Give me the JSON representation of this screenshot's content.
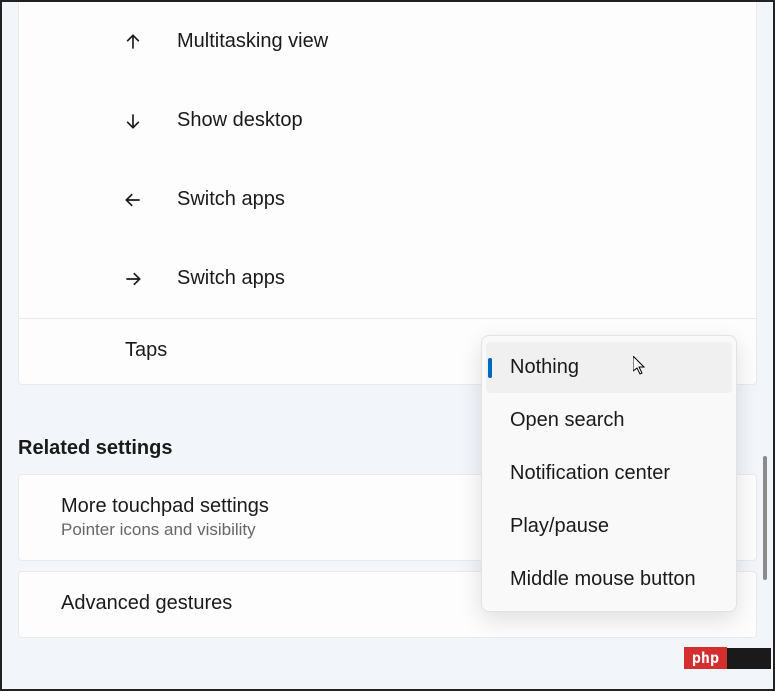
{
  "gestures": [
    {
      "label": "Multitasking view",
      "icon": "arrow-up"
    },
    {
      "label": "Show desktop",
      "icon": "arrow-down"
    },
    {
      "label": "Switch apps",
      "icon": "arrow-left"
    },
    {
      "label": "Switch apps",
      "icon": "arrow-right"
    }
  ],
  "taps": {
    "label": "Taps"
  },
  "dropdown": {
    "items": [
      {
        "label": "Nothing",
        "selected": true
      },
      {
        "label": "Open search",
        "selected": false
      },
      {
        "label": "Notification center",
        "selected": false
      },
      {
        "label": "Play/pause",
        "selected": false
      },
      {
        "label": "Middle mouse button",
        "selected": false
      }
    ]
  },
  "related": {
    "header": "Related settings",
    "more_touchpad": {
      "title": "More touchpad settings",
      "subtitle": "Pointer icons and visibility"
    },
    "advanced": {
      "title": "Advanced gestures"
    }
  },
  "badge": {
    "php": "php"
  }
}
